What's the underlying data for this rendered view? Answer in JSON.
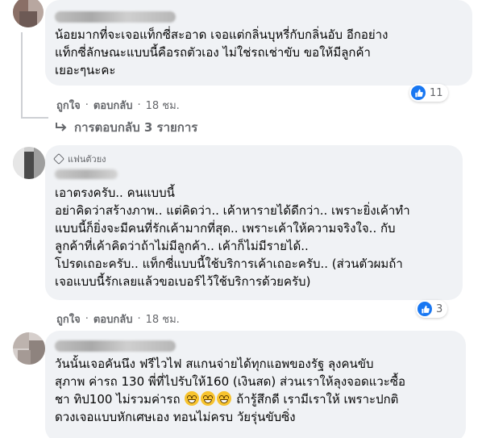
{
  "comments": [
    {
      "lines": [
        "น้อยมากที่จะเจอแท็กซี่สะอาด เจอแต่กลิ่นบุหรี่กับกลิ่นอับ อีกอย่าง",
        "แท็กซี่ลักษณะแบบนี้คือรถตัวเอง ไม่ใช่รถเช่าขับ ขอให้มีลูกค้า",
        "เยอะๆนะคะ"
      ],
      "reactions": "11",
      "like_label": "ถูกใจ",
      "reply_label": "ตอบกลับ",
      "time": "18 ชม."
    },
    {
      "badge": "แฟนตัวยง",
      "lines": [
        "เอาตรงครับ.. คนแบบนี้",
        "อย่าคิดว่าสร้างภาพ.. แต่คิดว่า.. เค้าหารายได้ดีกว่า.. เพราะยิ่งเค้าทำ",
        "แบบนี้ก็ยิ่งจะมีคนที่รักเค้ามากที่สุด.. เพราะเค้าให้ความจริงใจ.. กับ",
        "ลูกค้าที่เค้าคิดว่าถ้าไม่มีลูกค้า.. เค้าก็ไม่มีรายได้..",
        "โปรดเถอะครับ.. แท็กซี่แบบนี้ใช้บริการเค้าเถอะครับ.. (ส่วนตัวผมถ้า",
        "เจอแบบนี้รักเลยแล้วขอเบอร์ไว้ใช้บริการด้วยครับ)"
      ],
      "reactions": "3",
      "like_label": "ถูกใจ",
      "reply_label": "ตอบกลับ",
      "time": "18 ชม."
    },
    {
      "lines": [
        "วันนั้นเจอคันนึง ฟรีไวไฟ สแกนจ่ายได้ทุกแอพของรัฐ ลุงคนขับ",
        "สุภาพ ค่ารถ 130 พี่ที่ไปรับให้160 (เงินสด) ส่วนเราให้ลุงจอดแวะซื้อ",
        "ดวงเจอแบบหักเศษเอง ทอนไม่ครบ วัยรุ่นขับซิ่ง"
      ],
      "line3_start": "ชา ทิป100 ไม่รวมค่ารถ",
      "line3_end": "ถ้ารู้สึกดี เรามีเราให้ เพราะปกติ"
    }
  ],
  "replies_link": "การตอบกลับ 3 รายการ",
  "colors": {
    "bubble": "#f0f2f5",
    "meta": "#65676b",
    "like_blue": "#1877f2"
  }
}
